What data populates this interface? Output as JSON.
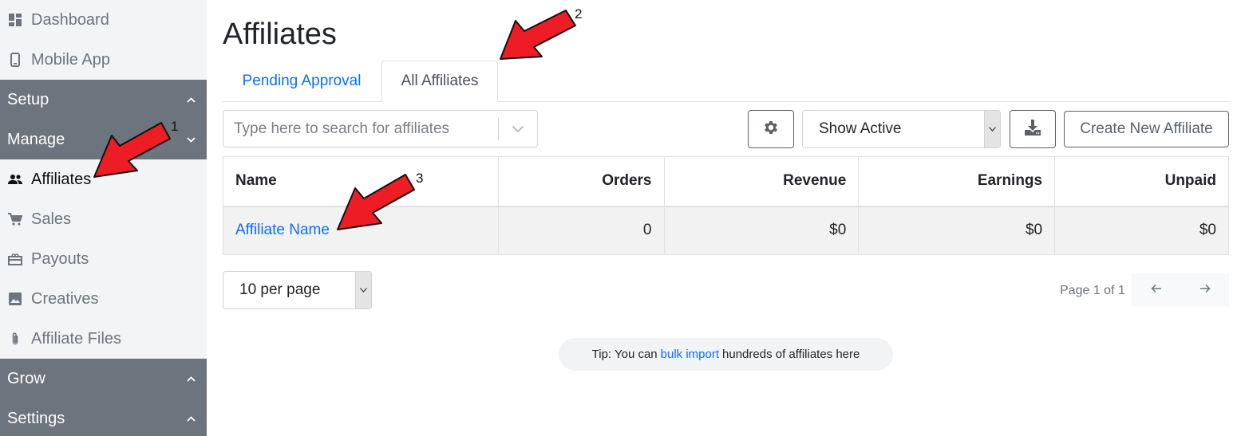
{
  "sidebar": {
    "items_top": [
      {
        "label": "Dashboard",
        "icon": "dashboard-icon"
      },
      {
        "label": "Mobile App",
        "icon": "mobile-icon"
      }
    ],
    "sections": {
      "setup": "Setup",
      "manage": "Manage",
      "grow": "Grow",
      "settings": "Settings"
    },
    "manage_items": [
      {
        "label": "Affiliates",
        "icon": "people-icon",
        "active": true
      },
      {
        "label": "Sales",
        "icon": "cart-icon"
      },
      {
        "label": "Payouts",
        "icon": "payouts-icon"
      },
      {
        "label": "Creatives",
        "icon": "image-icon"
      },
      {
        "label": "Affiliate Files",
        "icon": "paperclip-icon"
      }
    ]
  },
  "main": {
    "title": "Affiliates",
    "tabs": [
      {
        "label": "Pending Approval"
      },
      {
        "label": "All Affiliates",
        "active": true
      }
    ],
    "search": {
      "placeholder": "Type here to search for affiliates"
    },
    "filter": {
      "selected": "Show Active"
    },
    "create_button": "Create New Affiliate",
    "table": {
      "headers": [
        "Name",
        "Orders",
        "Revenue",
        "Earnings",
        "Unpaid"
      ],
      "rows": [
        {
          "name": "Affiliate Name",
          "orders": "0",
          "revenue": "$0",
          "earnings": "$0",
          "unpaid": "$0"
        }
      ]
    },
    "per_page": "10 per page",
    "page_info": "Page 1 of 1",
    "tip": {
      "prefix": "Tip: You can",
      "link": "bulk import",
      "suffix": "hundreds of affiliates here"
    }
  },
  "annotations": {
    "labels": [
      "1",
      "2",
      "3"
    ],
    "arrow_color": "#ee1c25"
  }
}
